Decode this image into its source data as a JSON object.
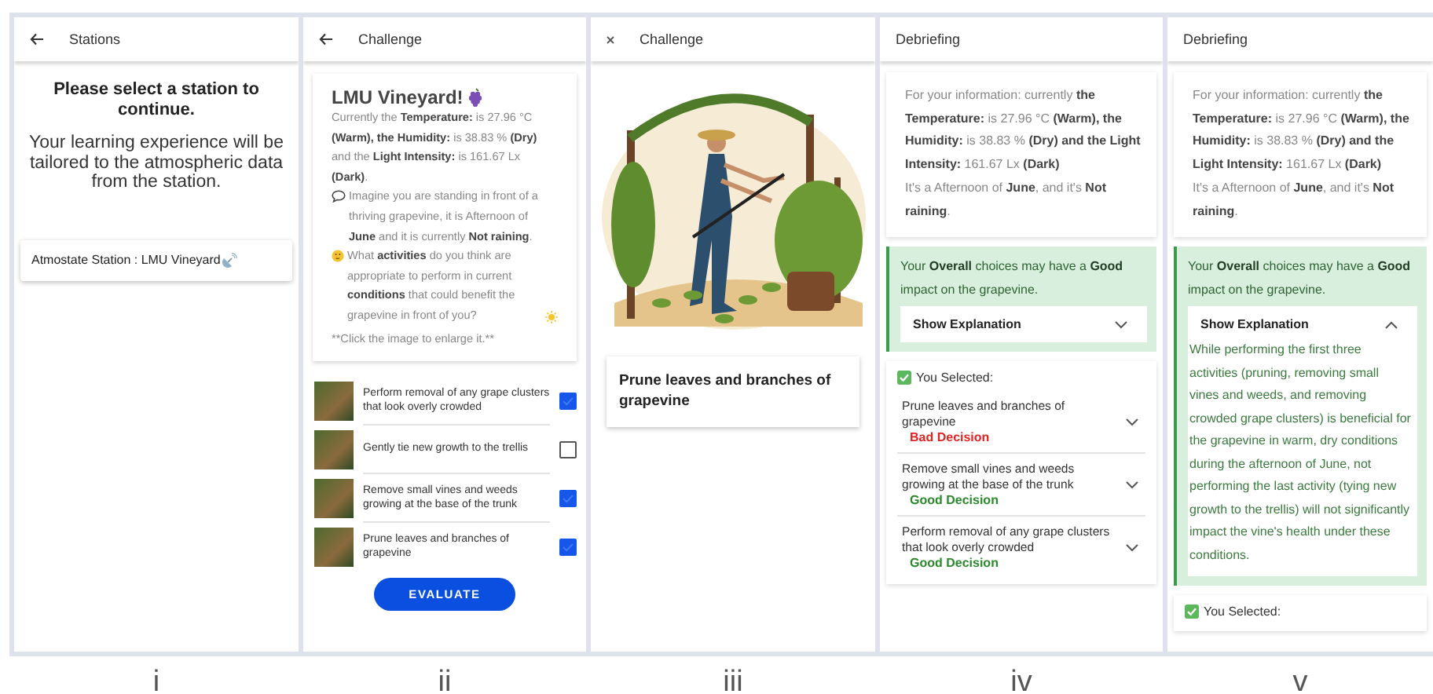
{
  "panels": [
    {
      "kind": "stations",
      "caption": "i",
      "header": {
        "title": "Stations",
        "kind": "back"
      },
      "heading": "Please select a station to continue.",
      "subtitle": "Your learning experience will be tailored to the atmospheric data from the station.",
      "station": "Atmostate Station : LMU Vineyard"
    },
    {
      "kind": "challenge",
      "caption": "ii",
      "header": {
        "title": "Challenge",
        "kind": "back"
      },
      "title": "LMU Vineyard!",
      "paragraphs": [
        {
          "kind": "plain",
          "text": "Currently the **Temperature:** is 27.96 °C **(Warm), the Humidity:** is 38.83 % **(Dry)** and the **Light Intensity:** is 161.67 Lx **(Dark)**."
        },
        {
          "kind": "speech",
          "text": "Imagine you are standing in front of a thriving grapevine, it is Afternoon of **June** and it is currently **Not raining**."
        },
        {
          "kind": "question",
          "text": "What **activities** do you think are appropriate to perform in current **conditions** that could benefit the grapevine in front of you?"
        }
      ],
      "note": "**Click the image to enlarge it.**",
      "activities": [
        {
          "label": "Perform removal of any grape clusters that look overly crowded",
          "checked": true
        },
        {
          "label": "Gently tie new growth to the trellis",
          "checked": false
        },
        {
          "label": "Remove small vines and weeds growing at the base of the trunk",
          "checked": true
        },
        {
          "label": "Prune leaves and branches of grapevine",
          "checked": true
        }
      ],
      "button": "EVALUATE"
    },
    {
      "kind": "image",
      "caption": "iii",
      "header": {
        "title": "Challenge",
        "kind": "close"
      },
      "card_title": "Prune leaves and branches of grapevine"
    },
    {
      "kind": "debrief",
      "caption": "iv",
      "header": {
        "title": "Debriefing",
        "kind": "plain"
      },
      "info": [
        "For your information: currently **the Temperature:** is 27.96 °C **(Warm), the Humidity:** is 38.83 % **(Dry) and the Light Intensity:** 161.67 Lx **(Dark)**",
        "It's a Afternoon of **June**, and it's **Not raining**."
      ],
      "result": "Your **Overall** choices may have a **Good** impact on the grapevine.",
      "explanation_toggle": "Show Explanation",
      "expanded": false,
      "selected_title": "You Selected:",
      "selected": [
        {
          "label": "Prune leaves and branches of grapevine",
          "decision": "Bad Decision",
          "kind": "bad"
        },
        {
          "label": "Remove small vines and weeds growing at the base of the trunk",
          "decision": "Good Decision",
          "kind": "good"
        },
        {
          "label": "Perform removal of any grape clusters that look overly crowded",
          "decision": "Good Decision",
          "kind": "good"
        }
      ]
    },
    {
      "kind": "debrief",
      "caption": "v",
      "header": {
        "title": "Debriefing",
        "kind": "plain"
      },
      "info": [
        "For your information: currently **the Temperature:** is 27.96 °C **(Warm), the Humidity:** is 38.83 % **(Dry) and the Light Intensity:** 161.67 Lx **(Dark)**",
        "It's a Afternoon of **June**, and it's **Not raining**."
      ],
      "result": "Your **Overall** choices may have a **Good** impact on the grapevine.",
      "explanation_toggle": "Show Explanation",
      "expanded": true,
      "explanation": "While performing the first three activities (pruning, removing small vines and weeds, and removing crowded grape clusters) is beneficial for the grapevine in warm, dry conditions during the afternoon of June, not performing the last activity (tying new growth to the trellis) will not significantly impact the vine's health under these conditions.",
      "selected_title": "You Selected:"
    }
  ]
}
